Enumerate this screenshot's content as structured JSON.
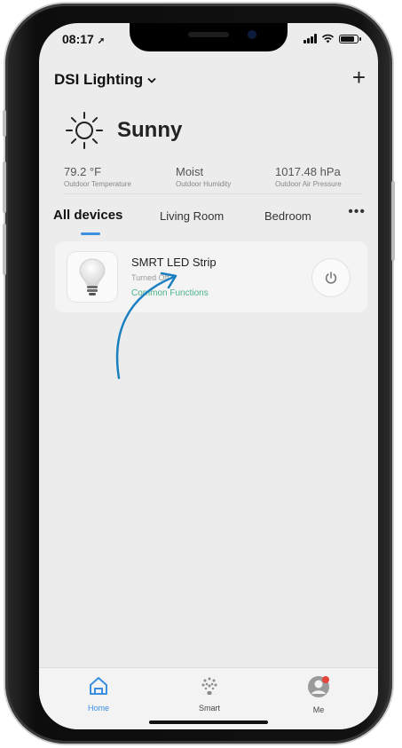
{
  "status_bar": {
    "time": "08:17"
  },
  "header": {
    "title": "DSI Lighting",
    "add_label": "+"
  },
  "weather": {
    "condition": "Sunny",
    "stats": [
      {
        "value": "79.2 °F",
        "label": "Outdoor Temperature"
      },
      {
        "value": "Moist",
        "label": "Outdoor Humidity"
      },
      {
        "value": "1017.48 hPa",
        "label": "Outdoor Air Pressure"
      }
    ]
  },
  "tabs": [
    {
      "label": "All devices",
      "active": true
    },
    {
      "label": "Living Room",
      "active": false
    },
    {
      "label": "Bedroom",
      "active": false
    }
  ],
  "more_label": "•••",
  "device": {
    "name": "SMRT LED Strip",
    "status": "Turned Off",
    "functions_link": "Common Functions",
    "icon": "light-bulb-icon"
  },
  "tabbar": [
    {
      "label": "Home",
      "icon": "home-icon",
      "active": true
    },
    {
      "label": "Smart",
      "icon": "smart-icon",
      "active": false
    },
    {
      "label": "Me",
      "icon": "profile-icon",
      "active": false
    }
  ],
  "colors": {
    "accent": "#3a8fe0",
    "link": "#4bb38a",
    "annotation_arrow": "#1a7fc0"
  }
}
